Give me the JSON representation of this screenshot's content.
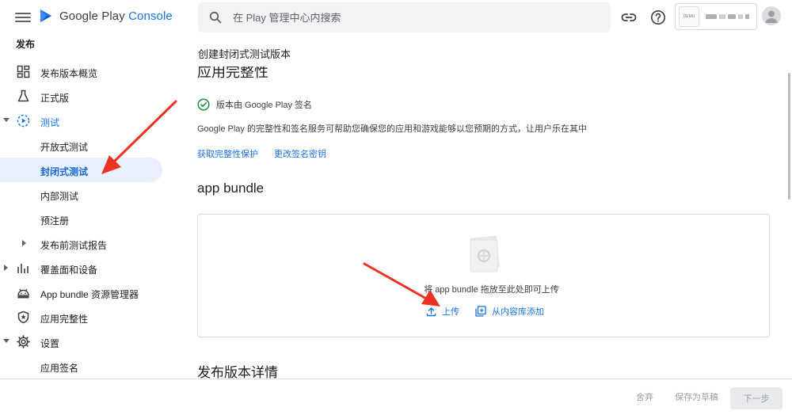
{
  "header": {
    "logo_google": "Google Play",
    "logo_console": "Console",
    "search_placeholder": "在 Play 管理中心内搜索",
    "account_logo_text": "DEMU"
  },
  "sidebar": {
    "section_title": "发布",
    "items": [
      {
        "label": "发布版本概览",
        "icon": "dashboard-icon"
      },
      {
        "label": "正式版",
        "icon": "flask-icon"
      },
      {
        "label": "测试",
        "icon": "test-play-icon"
      },
      {
        "label": "开放式测试"
      },
      {
        "label": "封闭式测试"
      },
      {
        "label": "内部测试"
      },
      {
        "label": "预注册"
      },
      {
        "label": "发布前测试报告"
      },
      {
        "label": "覆盖面和设备",
        "icon": "bar-chart-icon"
      },
      {
        "label": "App bundle 资源管理器",
        "icon": "android-icon"
      },
      {
        "label": "应用完整性",
        "icon": "shield-icon"
      },
      {
        "label": "设置",
        "icon": "gear-icon"
      },
      {
        "label": "应用签名"
      }
    ]
  },
  "main": {
    "page_title": "创建封闭式测试版本",
    "integrity_heading": "应用完整性",
    "signing_status": "版本由 Google Play 签名",
    "integrity_desc": "Google Play 的完整性和签名服务可帮助您确保您的应用和游戏能够以您预期的方式，让用户乐在其中",
    "link_integrity": "获取完整性保护",
    "link_change_key": "更改签名密钥",
    "bundle_heading": "app bundle",
    "drop_text": "将 app bundle 拖放至此处即可上传",
    "upload_label": "上传",
    "add_from_library_label": "从内容库添加",
    "release_details_heading": "发布版本详情"
  },
  "footer": {
    "discard_label": "舍弃",
    "save_draft_label": "保存为草稿",
    "next_label": "下一步"
  },
  "colors": {
    "accent": "#1a73e8",
    "selected_bg": "#e8f0fe",
    "success": "#1e8e3e",
    "annotation_arrow": "#ea3323"
  }
}
